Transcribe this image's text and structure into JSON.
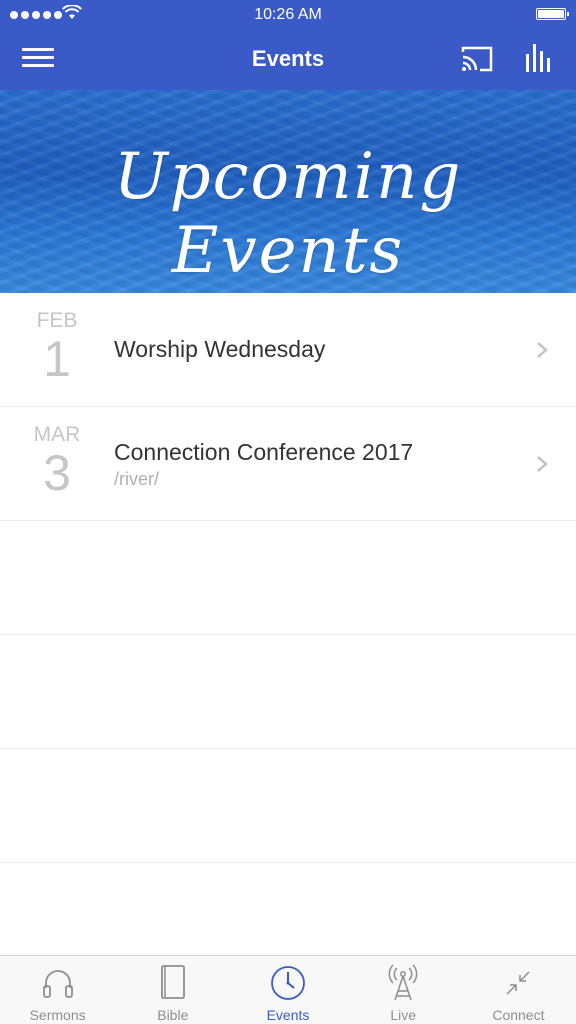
{
  "status_bar": {
    "time": "10:26 AM",
    "signal_icon": "signal-dots-icon",
    "wifi_icon": "wifi-icon",
    "battery_icon": "battery-icon"
  },
  "nav": {
    "title": "Events",
    "menu_icon": "hamburger-menu-icon",
    "cast_icon": "cast-icon",
    "stats_icon": "bar-chart-icon",
    "accent_color": "#3a5bc7"
  },
  "banner": {
    "text": "Upcoming Events"
  },
  "events": [
    {
      "month": "FEB",
      "day": "1",
      "title": "Worship Wednesday",
      "subtitle": ""
    },
    {
      "month": "MAR",
      "day": "3",
      "title": "Connection Conference 2017",
      "subtitle": "/river/"
    }
  ],
  "tabs": [
    {
      "label": "Sermons",
      "icon": "headphones-icon",
      "active": false
    },
    {
      "label": "Bible",
      "icon": "book-icon",
      "active": false
    },
    {
      "label": "Events",
      "icon": "clock-icon",
      "active": true
    },
    {
      "label": "Live",
      "icon": "broadcast-tower-icon",
      "active": false
    },
    {
      "label": "Connect",
      "icon": "arrows-collapse-icon",
      "active": false
    }
  ]
}
